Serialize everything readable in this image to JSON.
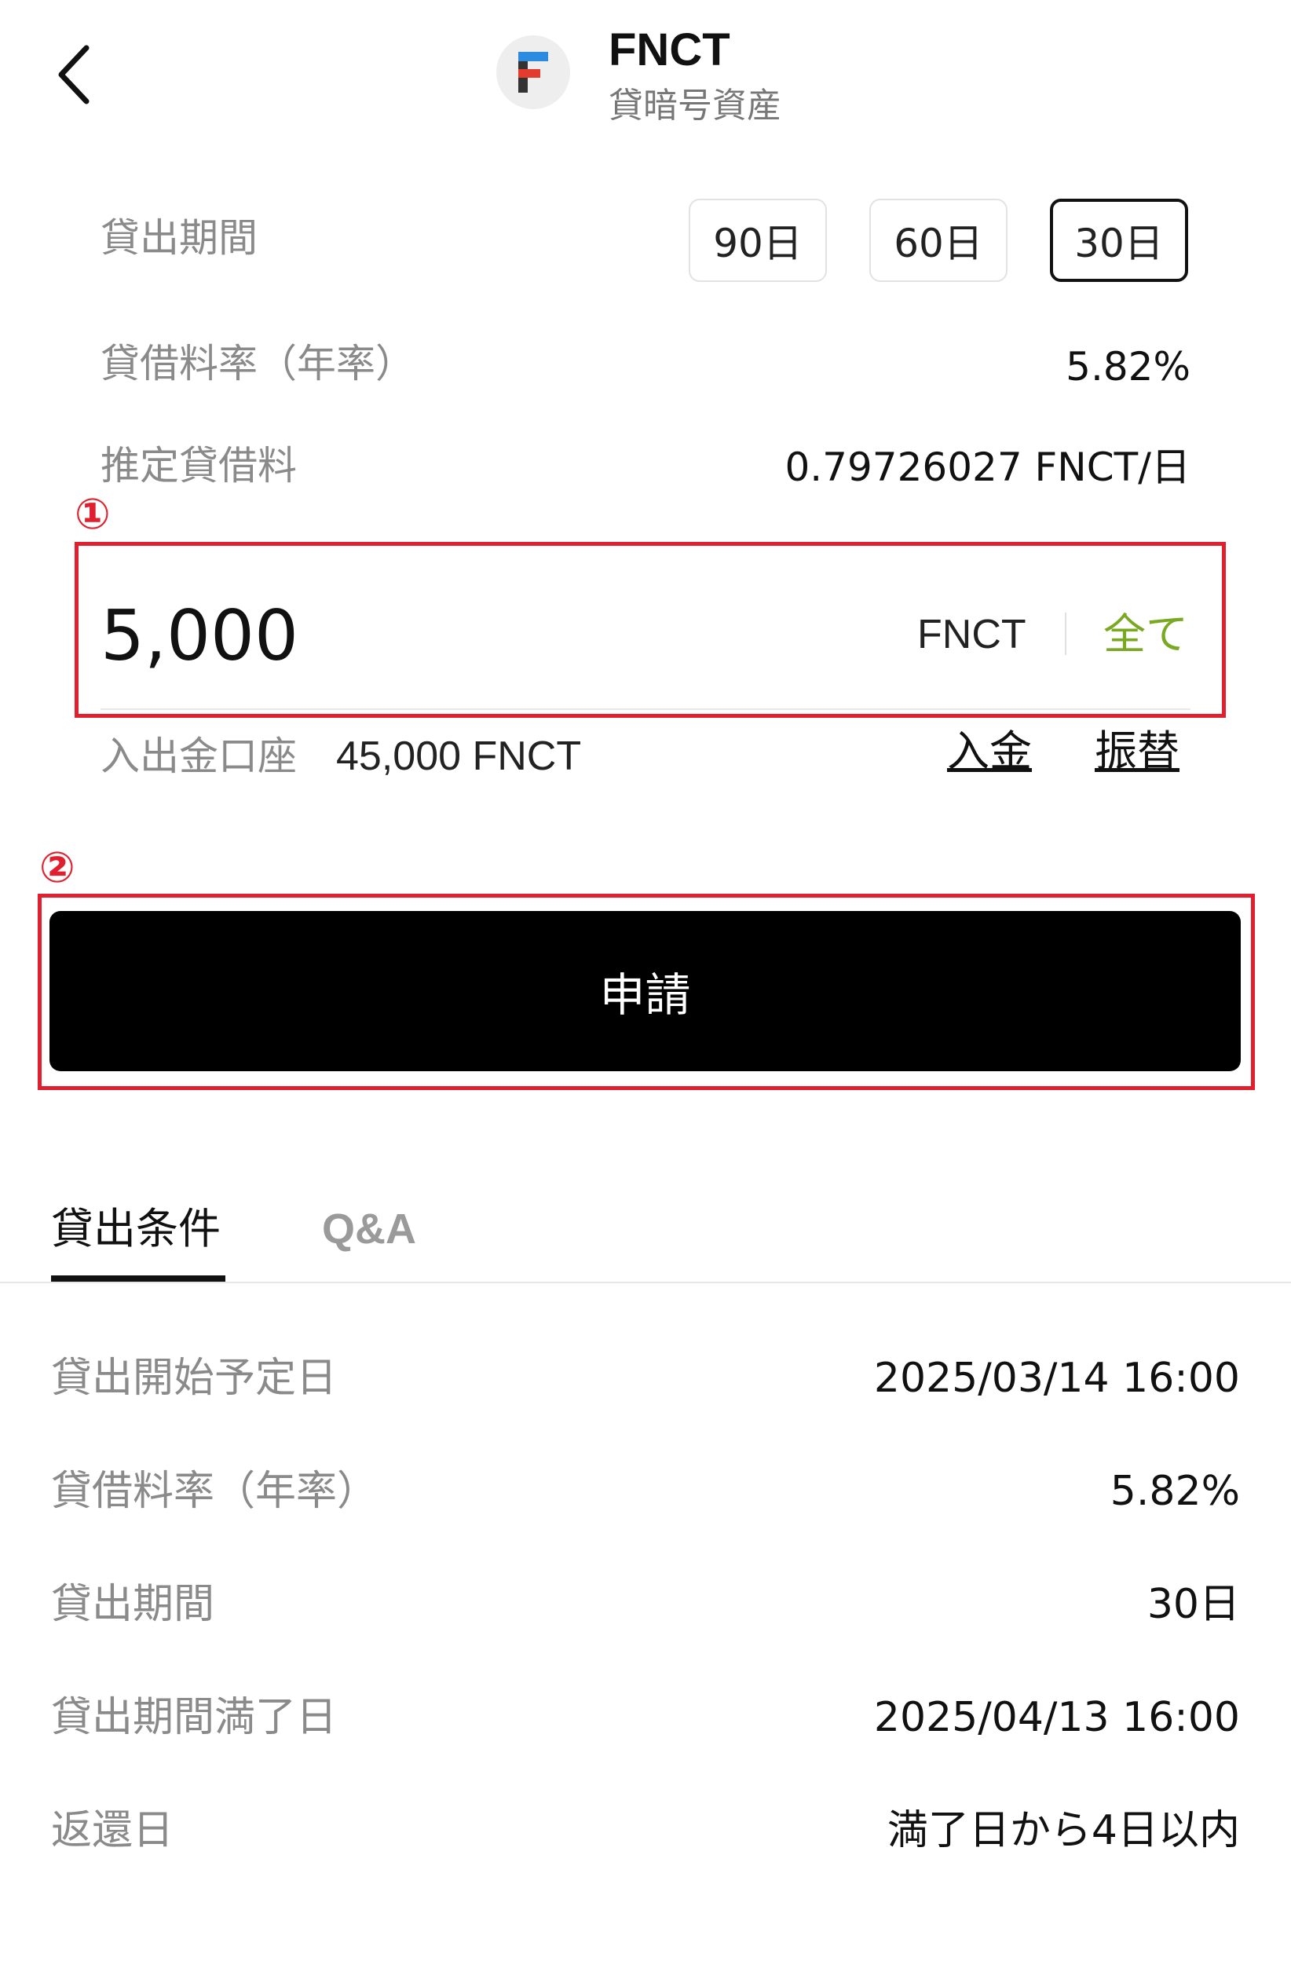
{
  "header": {
    "title": "FNCT",
    "subtitle": "貸暗号資産",
    "logo_letter": "F",
    "back_icon": "chevron-left-icon"
  },
  "form": {
    "period": {
      "label": "貸出期間",
      "options": [
        "90日",
        "60日",
        "30日"
      ],
      "selected": "30日"
    },
    "rate": {
      "label": "貸借料率（年率）",
      "value": "5.82%"
    },
    "estimated_fee": {
      "label": "推定貸借料",
      "value": "0.79726027 FNCT/日"
    },
    "amount": {
      "value": "5,000",
      "unit": "FNCT",
      "all_label": "全て"
    },
    "account": {
      "label": "入出金口座",
      "balance": "45,000 FNCT",
      "deposit_label": "入金",
      "transfer_label": "振替"
    },
    "submit_label": "申請"
  },
  "annotations": {
    "marker_1": "①",
    "marker_2": "②",
    "highlight_color": "#e0202e"
  },
  "tabs": {
    "items": [
      "貸出条件",
      "Q&A"
    ],
    "active": "貸出条件"
  },
  "conditions": [
    {
      "label": "貸出開始予定日",
      "value": "2025/03/14 16:00"
    },
    {
      "label": "貸借料率（年率）",
      "value": "5.82%"
    },
    {
      "label": "貸出期間",
      "value": "30日"
    },
    {
      "label": "貸出期間満了日",
      "value": "2025/04/13 16:00"
    },
    {
      "label": "返還日",
      "value": "満了日から4日以内"
    }
  ],
  "colors": {
    "accent_green": "#79a821",
    "button_black": "#000000"
  }
}
